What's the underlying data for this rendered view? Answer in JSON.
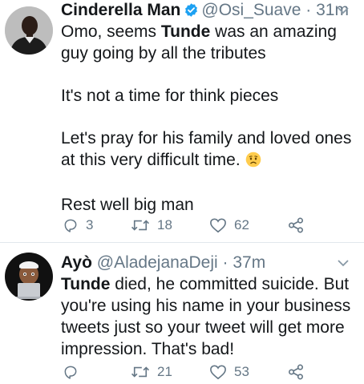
{
  "tweets": [
    {
      "author_name": "Cinderella Man",
      "verified": true,
      "handle": "@Osi_Suave",
      "separator": "·",
      "time": "31m",
      "lines": {
        "l1_prefix": "Omo, seems ",
        "l1_bold": "Tunde",
        "l1_suffix": " was an amazing guy going by all the tributes",
        "l2": "It's not a time for think pieces",
        "l3": "Let's pray for his family and loved ones  at this very difficult time.",
        "l4": "Rest well big man"
      },
      "emoji": "worried-face-emoji",
      "replies": "3",
      "retweets": "18",
      "likes": "62"
    },
    {
      "author_name": "Ayò",
      "verified": false,
      "handle": "@AladejanaDeji",
      "separator": "·",
      "time": "37m",
      "lines": {
        "l1_bold": "Tunde",
        "l1_suffix": " died, he committed suicide. But you're using his name in your business tweets just so your tweet will get more impression. That's bad!"
      },
      "replies": "",
      "retweets": "21",
      "likes": "53"
    }
  ],
  "icons": {
    "reply": "reply-icon",
    "retweet": "retweet-icon",
    "like": "heart-icon",
    "share": "share-icon",
    "menu": "chevron-down-icon",
    "verified": "verified-badge-icon"
  },
  "colors": {
    "text": "#14171a",
    "secondary": "#657786",
    "verified": "#1da1f2",
    "divider": "#e1e8ed"
  }
}
